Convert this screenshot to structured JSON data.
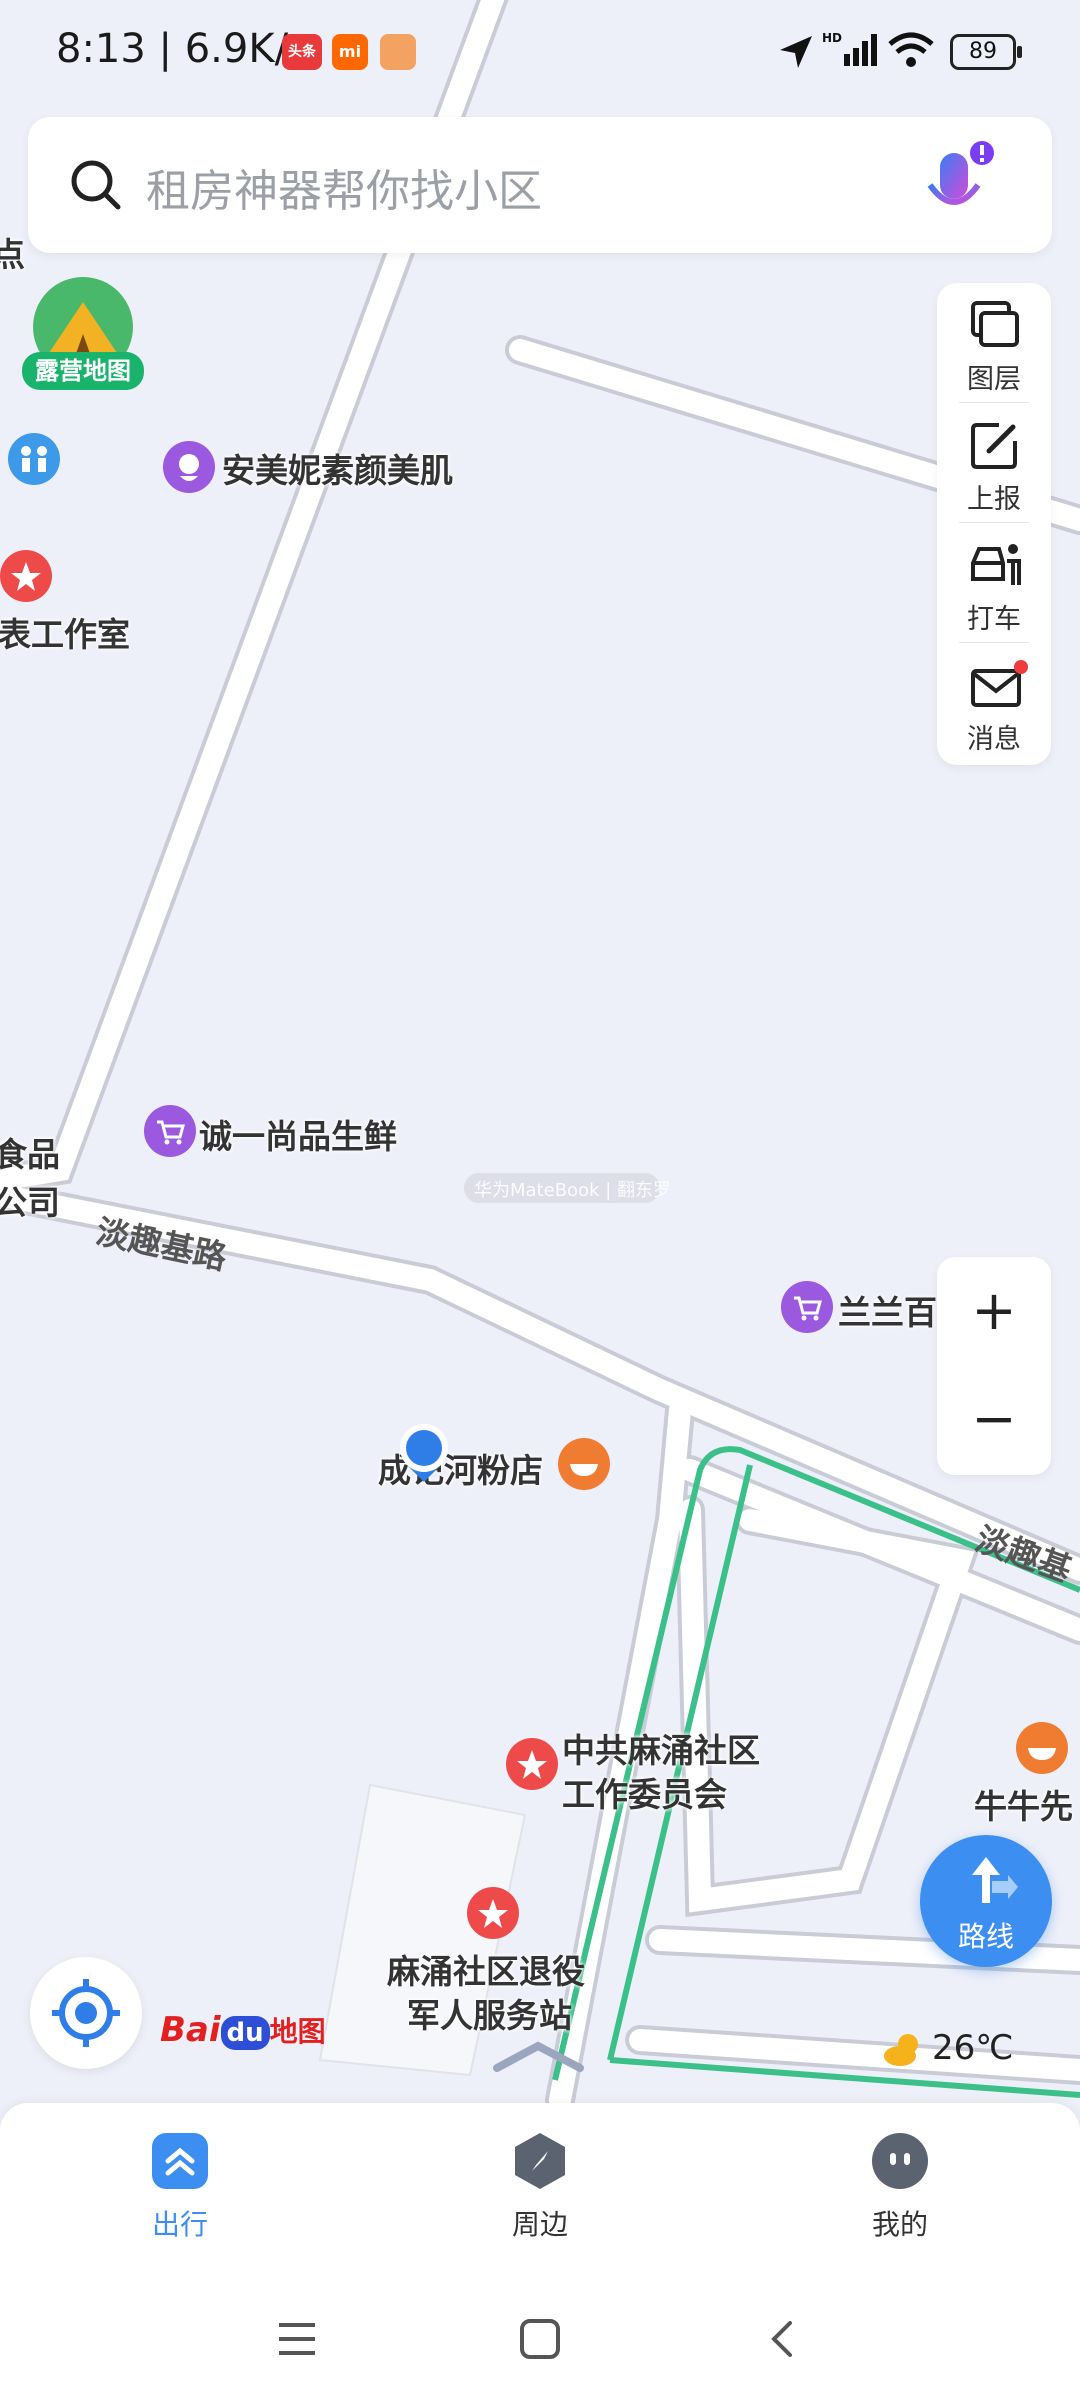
{
  "status_bar": {
    "time_speed": "8:13 | 6.9K/s",
    "app_icon_1": "头条",
    "app_icon_2": "mi",
    "battery": "89",
    "icons": [
      "location-arrow-icon",
      "hd-signal-icon",
      "wifi-icon"
    ]
  },
  "search": {
    "placeholder": "租房神器帮你找小区",
    "voice_icon": "microphone-icon"
  },
  "camp_map": {
    "label": "露营地图"
  },
  "tools": [
    {
      "label": "图层",
      "icon": "layers-icon"
    },
    {
      "label": "上报",
      "icon": "report-edit-icon"
    },
    {
      "label": "打车",
      "icon": "taxi-icon"
    },
    {
      "label": "消息",
      "icon": "mail-icon"
    }
  ],
  "map": {
    "pois": {
      "beauty": "安美妮素颜美肌",
      "studio": "表工作室",
      "dian": "点",
      "grocery": "诚一尚品生鲜",
      "food_co_1": "食品",
      "food_co_2": "公司",
      "lanlan": "兰兰百",
      "noodle": "成记河粉店",
      "party_1": "中共麻涌社区",
      "party_2": "工作委员会",
      "niuniu": "牛牛先",
      "veteran_1": "麻涌社区退役",
      "veteran_2": "军人服务站"
    },
    "roads": {
      "danqu_1": "淡趣基路",
      "danqu_2": "淡趣基"
    },
    "ad_text": "华为MateBook | 翻东罗"
  },
  "zoom": {
    "in": "+",
    "out": "−"
  },
  "route_button": {
    "label": "路线"
  },
  "weather": {
    "temp": "26℃",
    "icon": "cloud-sun-icon"
  },
  "logo": {
    "text": "Bai",
    "text2": "du",
    "text3": "地图"
  },
  "bottom_nav": [
    {
      "label": "出行",
      "icon": "travel-icon",
      "active": true
    },
    {
      "label": "周边",
      "icon": "compass-icon",
      "active": false
    },
    {
      "label": "我的",
      "icon": "profile-icon",
      "active": false
    }
  ],
  "colors": {
    "accent": "#3c8ff0",
    "route_green": "#3cc08a",
    "poi_purple": "#9b59e0",
    "poi_red": "#ee4a4a",
    "poi_orange": "#f07c32"
  }
}
